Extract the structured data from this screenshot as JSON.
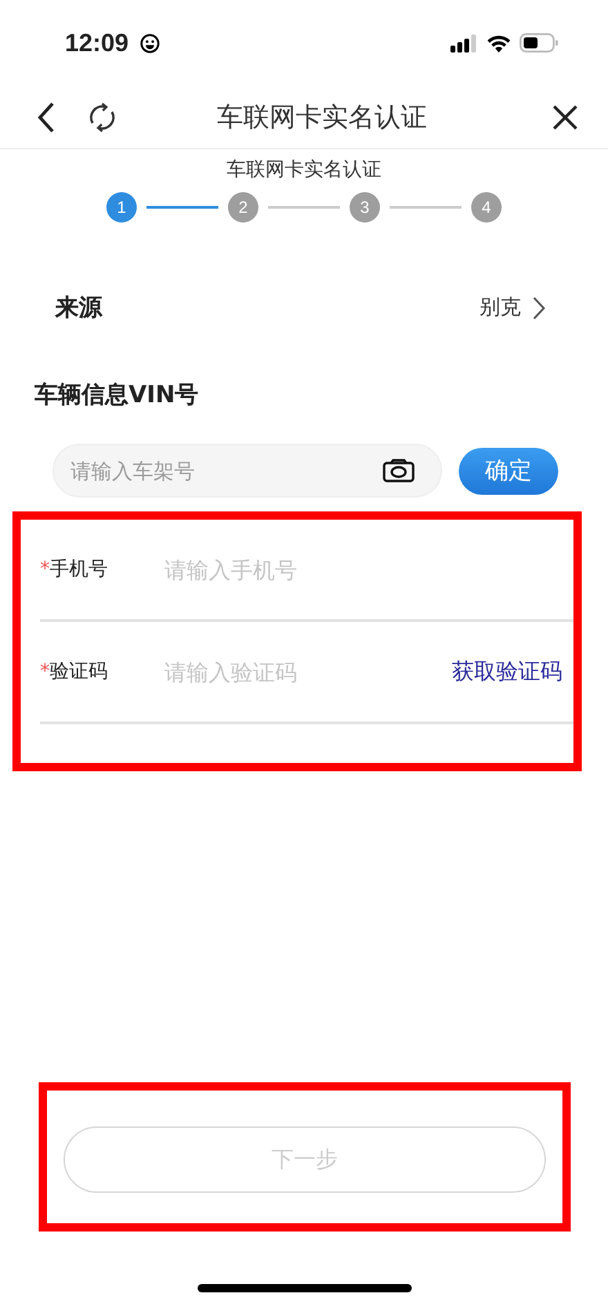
{
  "status_bar": {
    "time": "12:09"
  },
  "nav": {
    "title": "车联网卡实名认证"
  },
  "steps_title": "车联网卡实名认证",
  "steps": [
    {
      "label": "1",
      "selected": true
    },
    {
      "label": "2",
      "selected": false
    },
    {
      "label": "3",
      "selected": false
    },
    {
      "label": "4",
      "selected": false
    }
  ],
  "source": {
    "label": "来源",
    "value": "别克"
  },
  "vin": {
    "label": "车辆信息VIN号",
    "placeholder": "请输入车架号",
    "confirm": "确定"
  },
  "form": {
    "highlighted": true,
    "fields": [
      {
        "label": "手机号",
        "required_mark": "*",
        "placeholder": "请输入手机号"
      },
      {
        "label": "验证码",
        "required_mark": "*",
        "placeholder": "请输入验证码",
        "action": "获取验证码"
      }
    ]
  },
  "next": {
    "label": "下一步",
    "disabled": true,
    "highlighted": true
  }
}
